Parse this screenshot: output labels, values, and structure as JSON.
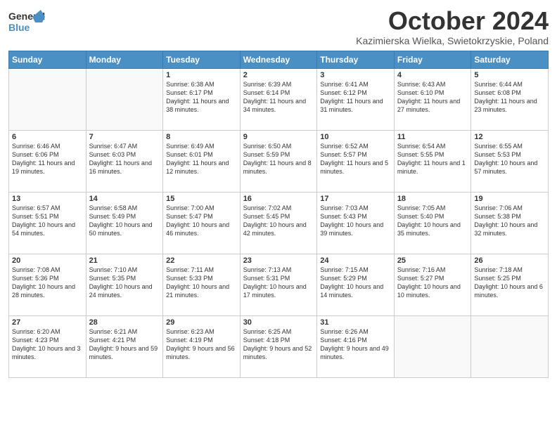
{
  "header": {
    "logo_general": "General",
    "logo_blue": "Blue",
    "month": "October 2024",
    "location": "Kazimierska Wielka, Swietokrzyskie, Poland"
  },
  "weekdays": [
    "Sunday",
    "Monday",
    "Tuesday",
    "Wednesday",
    "Thursday",
    "Friday",
    "Saturday"
  ],
  "weeks": [
    [
      {
        "day": "",
        "sunrise": "",
        "sunset": "",
        "daylight": ""
      },
      {
        "day": "",
        "sunrise": "",
        "sunset": "",
        "daylight": ""
      },
      {
        "day": "1",
        "sunrise": "Sunrise: 6:38 AM",
        "sunset": "Sunset: 6:17 PM",
        "daylight": "Daylight: 11 hours and 38 minutes."
      },
      {
        "day": "2",
        "sunrise": "Sunrise: 6:39 AM",
        "sunset": "Sunset: 6:14 PM",
        "daylight": "Daylight: 11 hours and 34 minutes."
      },
      {
        "day": "3",
        "sunrise": "Sunrise: 6:41 AM",
        "sunset": "Sunset: 6:12 PM",
        "daylight": "Daylight: 11 hours and 31 minutes."
      },
      {
        "day": "4",
        "sunrise": "Sunrise: 6:43 AM",
        "sunset": "Sunset: 6:10 PM",
        "daylight": "Daylight: 11 hours and 27 minutes."
      },
      {
        "day": "5",
        "sunrise": "Sunrise: 6:44 AM",
        "sunset": "Sunset: 6:08 PM",
        "daylight": "Daylight: 11 hours and 23 minutes."
      }
    ],
    [
      {
        "day": "6",
        "sunrise": "Sunrise: 6:46 AM",
        "sunset": "Sunset: 6:06 PM",
        "daylight": "Daylight: 11 hours and 19 minutes."
      },
      {
        "day": "7",
        "sunrise": "Sunrise: 6:47 AM",
        "sunset": "Sunset: 6:03 PM",
        "daylight": "Daylight: 11 hours and 16 minutes."
      },
      {
        "day": "8",
        "sunrise": "Sunrise: 6:49 AM",
        "sunset": "Sunset: 6:01 PM",
        "daylight": "Daylight: 11 hours and 12 minutes."
      },
      {
        "day": "9",
        "sunrise": "Sunrise: 6:50 AM",
        "sunset": "Sunset: 5:59 PM",
        "daylight": "Daylight: 11 hours and 8 minutes."
      },
      {
        "day": "10",
        "sunrise": "Sunrise: 6:52 AM",
        "sunset": "Sunset: 5:57 PM",
        "daylight": "Daylight: 11 hours and 5 minutes."
      },
      {
        "day": "11",
        "sunrise": "Sunrise: 6:54 AM",
        "sunset": "Sunset: 5:55 PM",
        "daylight": "Daylight: 11 hours and 1 minute."
      },
      {
        "day": "12",
        "sunrise": "Sunrise: 6:55 AM",
        "sunset": "Sunset: 5:53 PM",
        "daylight": "Daylight: 10 hours and 57 minutes."
      }
    ],
    [
      {
        "day": "13",
        "sunrise": "Sunrise: 6:57 AM",
        "sunset": "Sunset: 5:51 PM",
        "daylight": "Daylight: 10 hours and 54 minutes."
      },
      {
        "day": "14",
        "sunrise": "Sunrise: 6:58 AM",
        "sunset": "Sunset: 5:49 PM",
        "daylight": "Daylight: 10 hours and 50 minutes."
      },
      {
        "day": "15",
        "sunrise": "Sunrise: 7:00 AM",
        "sunset": "Sunset: 5:47 PM",
        "daylight": "Daylight: 10 hours and 46 minutes."
      },
      {
        "day": "16",
        "sunrise": "Sunrise: 7:02 AM",
        "sunset": "Sunset: 5:45 PM",
        "daylight": "Daylight: 10 hours and 42 minutes."
      },
      {
        "day": "17",
        "sunrise": "Sunrise: 7:03 AM",
        "sunset": "Sunset: 5:43 PM",
        "daylight": "Daylight: 10 hours and 39 minutes."
      },
      {
        "day": "18",
        "sunrise": "Sunrise: 7:05 AM",
        "sunset": "Sunset: 5:40 PM",
        "daylight": "Daylight: 10 hours and 35 minutes."
      },
      {
        "day": "19",
        "sunrise": "Sunrise: 7:06 AM",
        "sunset": "Sunset: 5:38 PM",
        "daylight": "Daylight: 10 hours and 32 minutes."
      }
    ],
    [
      {
        "day": "20",
        "sunrise": "Sunrise: 7:08 AM",
        "sunset": "Sunset: 5:36 PM",
        "daylight": "Daylight: 10 hours and 28 minutes."
      },
      {
        "day": "21",
        "sunrise": "Sunrise: 7:10 AM",
        "sunset": "Sunset: 5:35 PM",
        "daylight": "Daylight: 10 hours and 24 minutes."
      },
      {
        "day": "22",
        "sunrise": "Sunrise: 7:11 AM",
        "sunset": "Sunset: 5:33 PM",
        "daylight": "Daylight: 10 hours and 21 minutes."
      },
      {
        "day": "23",
        "sunrise": "Sunrise: 7:13 AM",
        "sunset": "Sunset: 5:31 PM",
        "daylight": "Daylight: 10 hours and 17 minutes."
      },
      {
        "day": "24",
        "sunrise": "Sunrise: 7:15 AM",
        "sunset": "Sunset: 5:29 PM",
        "daylight": "Daylight: 10 hours and 14 minutes."
      },
      {
        "day": "25",
        "sunrise": "Sunrise: 7:16 AM",
        "sunset": "Sunset: 5:27 PM",
        "daylight": "Daylight: 10 hours and 10 minutes."
      },
      {
        "day": "26",
        "sunrise": "Sunrise: 7:18 AM",
        "sunset": "Sunset: 5:25 PM",
        "daylight": "Daylight: 10 hours and 6 minutes."
      }
    ],
    [
      {
        "day": "27",
        "sunrise": "Sunrise: 6:20 AM",
        "sunset": "Sunset: 4:23 PM",
        "daylight": "Daylight: 10 hours and 3 minutes."
      },
      {
        "day": "28",
        "sunrise": "Sunrise: 6:21 AM",
        "sunset": "Sunset: 4:21 PM",
        "daylight": "Daylight: 9 hours and 59 minutes."
      },
      {
        "day": "29",
        "sunrise": "Sunrise: 6:23 AM",
        "sunset": "Sunset: 4:19 PM",
        "daylight": "Daylight: 9 hours and 56 minutes."
      },
      {
        "day": "30",
        "sunrise": "Sunrise: 6:25 AM",
        "sunset": "Sunset: 4:18 PM",
        "daylight": "Daylight: 9 hours and 52 minutes."
      },
      {
        "day": "31",
        "sunrise": "Sunrise: 6:26 AM",
        "sunset": "Sunset: 4:16 PM",
        "daylight": "Daylight: 9 hours and 49 minutes."
      },
      {
        "day": "",
        "sunrise": "",
        "sunset": "",
        "daylight": ""
      },
      {
        "day": "",
        "sunrise": "",
        "sunset": "",
        "daylight": ""
      }
    ]
  ]
}
